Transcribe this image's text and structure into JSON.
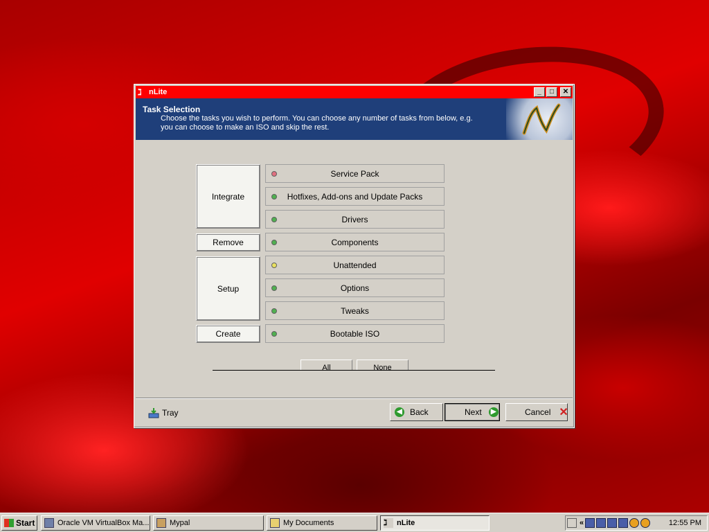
{
  "window": {
    "title": "nLite",
    "controls": [
      "_",
      "□",
      "✕"
    ]
  },
  "header": {
    "title": "Task Selection",
    "description_line1": "Choose the tasks you wish to perform. You can choose any number of tasks from below, e.g.",
    "description_line2": "you can choose to make an ISO and skip the rest."
  },
  "groups": {
    "integrate": "Integrate",
    "remove": "Remove",
    "setup": "Setup",
    "create": "Create"
  },
  "tasks": [
    {
      "label": "Service Pack",
      "status_color": "#e07080"
    },
    {
      "label": "Hotfixes, Add-ons and Update Packs",
      "status_color": "#50b050"
    },
    {
      "label": "Drivers",
      "status_color": "#50b050"
    },
    {
      "label": "Components",
      "status_color": "#50b050"
    },
    {
      "label": "Unattended",
      "status_color": "#e8e060"
    },
    {
      "label": "Options",
      "status_color": "#50b050"
    },
    {
      "label": "Tweaks",
      "status_color": "#50b050"
    },
    {
      "label": "Bootable ISO",
      "status_color": "#50b050"
    }
  ],
  "selection": {
    "all": "All",
    "none": "None"
  },
  "footer": {
    "tray": "Tray",
    "back": "Back",
    "next": "Next",
    "cancel": "Cancel"
  },
  "taskbar": {
    "start": "Start",
    "items": [
      {
        "label": "Oracle VM VirtualBox Ma..."
      },
      {
        "label": "Mypal"
      },
      {
        "label": "My Documents"
      },
      {
        "label": "nLite"
      }
    ],
    "tray_chevron": "«",
    "clock": "12:55 PM"
  },
  "colors": {
    "titlebar": "#ff0000",
    "header_bg": "#1f3f7a",
    "window_bg": "#d4d0c8"
  }
}
